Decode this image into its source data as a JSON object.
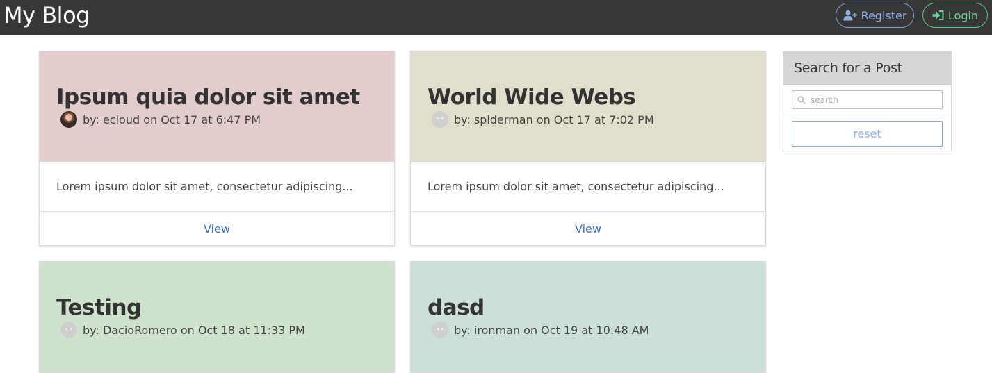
{
  "app": {
    "brand": "My Blog"
  },
  "nav": {
    "register_label": "Register",
    "login_label": "Login"
  },
  "posts": [
    {
      "title": "Ipsum quia dolor sit amet",
      "byline": "by: ecloud on Oct 17 at 6:47 PM",
      "excerpt": "Lorem ipsum dolor sit amet, consectetur adipiscing...",
      "link": "View",
      "color": "#e2cccc",
      "avatar": "photo"
    },
    {
      "title": "World Wide Webs",
      "byline": "by: spiderman on Oct 17 at 7:02 PM",
      "excerpt": "Lorem ipsum dolor sit amet, consectetur adipiscing...",
      "link": "View",
      "color": "#e1dfcc",
      "avatar": "blank"
    },
    {
      "title": "Testing",
      "byline": "by: DacioRomero on Oct 18 at 11:33 PM",
      "color": "#cfe2cd",
      "avatar": "blank"
    },
    {
      "title": "dasd",
      "byline": "by: ironman on Oct 19 at 10:48 AM",
      "color": "#cde0d8",
      "avatar": "blank"
    }
  ],
  "search": {
    "heading": "Search for a Post",
    "placeholder": "search",
    "value": "",
    "reset_label": "reset"
  },
  "colors": {
    "navbar": "#373737",
    "register_accent": "#8eaee8",
    "login_accent": "#6cd69a",
    "link": "#3a6fcf"
  },
  "icons": {
    "register": "user-plus-icon",
    "login": "sign-in-icon",
    "search": "search-icon"
  }
}
